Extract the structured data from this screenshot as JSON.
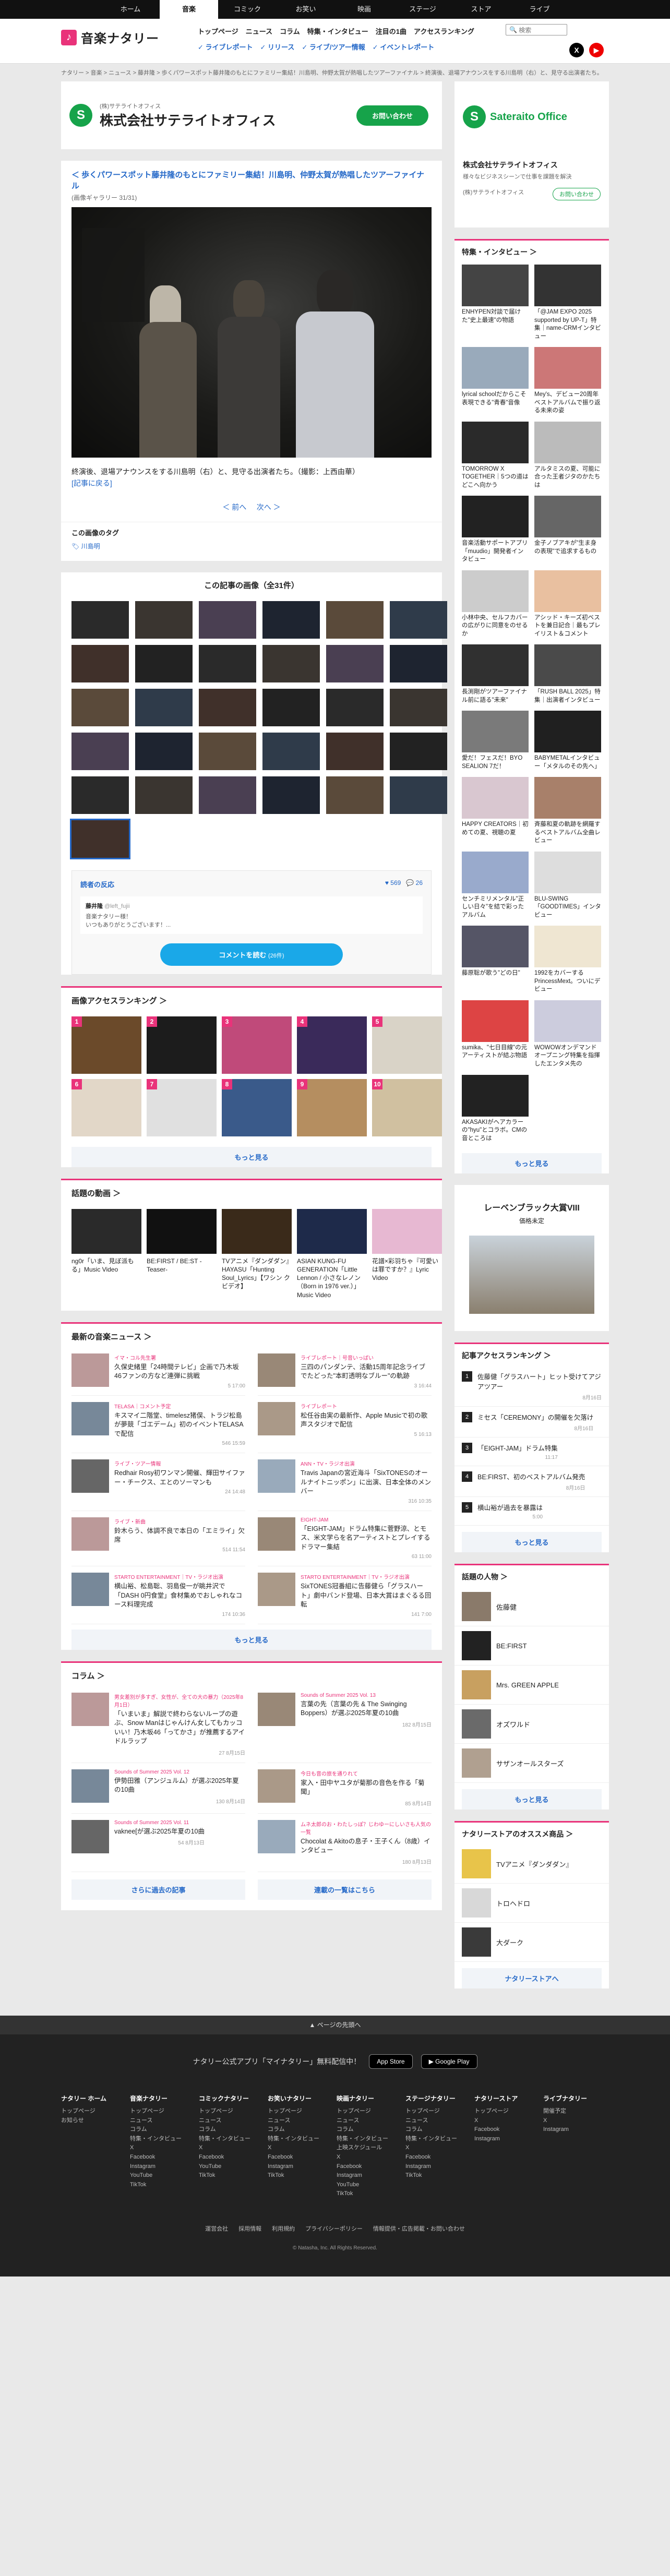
{
  "topnav": [
    "ホーム",
    "音楽",
    "コミック",
    "お笑い",
    "映画",
    "ステージ",
    "ストア",
    "ライブ"
  ],
  "header": {
    "logo": "音楽ナタリー",
    "search_placeholder": "検索",
    "menu1": [
      "トップページ",
      "ニュース",
      "コラム",
      "特集・インタビュー",
      "注目の1曲",
      "アクセスランキング"
    ],
    "menu2": [
      "ライブレポート",
      "リリース",
      "ライブ/ツアー情報",
      "イベントレポート"
    ]
  },
  "breadcrumb": "ナタリー > 音楽 > ニュース > 藤井隆 > 歩くパワースポット藤井隆のもとにファミリー集結！川島明、仲野太賀が熱唱したツアーファイナル > 終演後、退場アナウンスをする川島明（右）と、見守る出演者たち。",
  "ad_top": {
    "company_sub": "(株)サテライトオフィス",
    "company": "株式会社サテライトオフィス",
    "button": "お問い合わせ"
  },
  "article": {
    "back_link": "歩くパワースポット藤井隆のもとにファミリー集結！川島明、仲野太賀が熱唱したツアーファイナル",
    "gallery_count": "(画像ギャラリー 31/31)",
    "caption": "終演後、退場アナウンスをする川島明（右）と、見守る出演者たち。（撮影：上西由華）",
    "back_to_article": "[記事に戻る]",
    "prev": "＜ 前へ",
    "next": "次へ ＞",
    "tags_title": "この画像のタグ",
    "tag": "川島明"
  },
  "gallery": {
    "title": "この記事の画像（全31件）",
    "count": 31
  },
  "reactions": {
    "title": "読者の反応",
    "likes": "569",
    "comments": "26",
    "user": "藤井隆",
    "handle": "@left_fujii",
    "text": "音楽ナタリー様！\nいつもありがとうございます！...",
    "button": "コメントを読む",
    "button_count": "(26件)"
  },
  "image_ranking": {
    "title": "画像アクセスランキング",
    "more": "もっと見る",
    "count": 10
  },
  "videos": {
    "title": "話題の動画",
    "items": [
      {
        "title": "ng0r「いま、見ぼ派もる」Music Video"
      },
      {
        "title": "BE:FIRST / BE:ST -Teaser-"
      },
      {
        "title": "TVアニメ『ダンダダン』HAYASU「Hunting Soul_Lyrics」【ワシン クビデオ】"
      },
      {
        "title": "ASIAN KUNG-FU GENERATION「Little Lennon / 小さなレノン（Born in 1976 ver.）」Music Video"
      },
      {
        "title": "花譜×彩羽ちゃ『可愛いは罪ですか？』Lyric Video"
      }
    ]
  },
  "latest_news": {
    "title": "最新の音楽ニュース",
    "more": "もっと見る",
    "items": [
      {
        "cat": "イマ・コル先生署",
        "title": "久保史緒里「24時間テレビ」企画で乃木坂46ファンの方など連弾に挑戦",
        "meta": "5  17:00"
      },
      {
        "cat": "ライブレポート｜号音いっぱい",
        "title": "三四のパンダンテ、活動15周年記念ライブでたどった\"本町透明なブルー\"の軌跡",
        "meta": "3  16:44"
      },
      {
        "cat": "TELASA｜コメント予定",
        "title": "キスマイ二階堂、timelesz猪俣、トラジ松島が夢競「ゴエデーム」初のイベントTELASAで配信",
        "meta": "546  15:59"
      },
      {
        "cat": "ライブレポート",
        "title": "松任谷由実の最新作、Apple Musicで初の歌声スタジオで配信",
        "meta": "5  16:13"
      },
      {
        "cat": "ライブ・ツアー情報",
        "title": "Redhair Rosy初ワンマン開催、輝田サイファー・チークス、エとのソーマンも",
        "meta": "24  14:48"
      },
      {
        "cat": "ANN・TV・ラジオ出演",
        "title": "Travis Japanの宮近海斗「SixTONESのオールナイトニッポン」に出演、日本全体のメンバー",
        "meta": "316  10:35"
      },
      {
        "cat": "ライブ・新曲",
        "title": "鈴木らう、体調不良で本日の「エミライ」欠席",
        "meta": "514  11:54"
      },
      {
        "cat": "EIGHT-JAM",
        "title": "「EIGHT-JAM」ドラム特集に菅野涼、とモス、米文学らを名アーティストとプレイするドラマー集結",
        "meta": "63  11:00"
      },
      {
        "cat": "STARTO ENTERTAINMENT｜TV・ラジオ出演",
        "title": "横山裕、松島聡、羽島俊一が眺井沢で「DASH 0円食堂」食材集めでおしゃれなコース料理完成",
        "meta": "174  10:36"
      },
      {
        "cat": "STARTO ENTERTAINMENT｜TV・ラジオ出演",
        "title": "SixTONES冠番組に告藤健ら「グラスハート」劇中バンド登場、日本大賞はまぐるる回転",
        "meta": "141  7:00"
      }
    ]
  },
  "columns": {
    "title": "コラム",
    "more_left": "さらに過去の記事",
    "more_right": "連載の一覧はこちら",
    "items": [
      {
        "cat": "男女差別が多すぎ、女性が、全ての大の暴力（2025年8月1日）",
        "title": "「いまいま」解説で終わらないループの遊ぶ、Snow Manはじゃんけん女してもカッコいい！乃木坂46「ってかさ」が推薦するアイドルラップ",
        "meta": "27  8月15日"
      },
      {
        "cat": "Sounds of Summer 2025 Vol. 13",
        "title": "言葉の先（言葉の先 & The Swinging Boppers）が選ぶ2025年夏の10曲",
        "meta": "182  8月15日"
      },
      {
        "cat": "Sounds of Summer 2025 Vol. 12",
        "title": "伊勢田雅（アンジュルム）が選ぶ2025年夏の10曲",
        "meta": "130  8月14日"
      },
      {
        "cat": "今日も音の旅を通りれて",
        "title": "家入・田中ヤユタが菊那の音色を作る「菊聞」",
        "meta": "85  8月14日"
      },
      {
        "cat": "Sounds of Summer 2025 Vol. 11",
        "title": "vaknee[が選ぶ2025年夏の10曲",
        "meta": "54  8月13日"
      },
      {
        "cat": "ムネ太郎のお・わたしっぽ？じわゆーにしいさも人気の一覧",
        "title": "Chocolat & Akitoの息子・王子くん（8歳）インタビュー",
        "meta": "180  8月13日"
      }
    ]
  },
  "side_ad": {
    "company": "株式会社サテライトオフィス",
    "sub": "様々なビジネスシーンで仕事を課題を解決",
    "note": "(株)サテライトオフィス",
    "button": "お問い合わせ",
    "brand": "Sateraito Office"
  },
  "features": {
    "title": "特集・インタビュー",
    "more": "もっと見る",
    "items": [
      {
        "title": "ENHYPEN対談で届けた\"史上最速\"の物語"
      },
      {
        "title": "「@JAM EXPO 2025 supported by UP-T」特集｜name-CRMインタビュー"
      },
      {
        "title": "lyrical schoolだからこそ表現できる\"青春\"音像"
      },
      {
        "title": "Mey's、デビュー20周年ベストアルバムで振り返る未来の姿"
      },
      {
        "title": "TOMORROW X TOGETHER｜5つの道はどこへ向かう"
      },
      {
        "title": "アルタミスの夏、可能に合った王者ジタのかたちは"
      },
      {
        "title": "音楽活動サポートアプリ「muudio」開発者インタビュー"
      },
      {
        "title": "金子ノブアキが\"生ま身の表現\"で追求するもの"
      },
      {
        "title": "小林中央、セルフカバーの広がりに同意をのせるか"
      },
      {
        "title": "アシッド・キーズ初ベストを兼日記合｜最もプレイリスト＆コメント"
      },
      {
        "title": "長渕剛がツアーファイナル前に語る\"未来\""
      },
      {
        "title": "「RUSH BALL 2025」特集｜出演者インタビュー"
      },
      {
        "title": "愛だ！フェスだ！BYO SEALION 7だ！"
      },
      {
        "title": "BABYMETALインタビュー「メタルのその先へ」"
      },
      {
        "title": "HAPPY CREATORS｜初めての夏、視聴の夏"
      },
      {
        "title": "斉藤和夏の軌跡を網羅するベストアルバム全曲レビュー"
      },
      {
        "title": "センチミリメンタル\"正しい日々\"を結で彩ったアルバム"
      },
      {
        "title": "BLU-SWING「GOODTIMES」インタビュー"
      },
      {
        "title": "藤原聡が歌う\"どの日\""
      },
      {
        "title": "1992をカバーするPrincessMext。ついにデビュー"
      },
      {
        "title": "sumika、\"七日目線\"の元アーティストが結ぶ物語"
      },
      {
        "title": "WOWOWオンデマンドオープニング特集を指揮したエンタメ先の"
      },
      {
        "title": "AKASAKIがヘアカラー の\"hyu\"とコラボ。CMの音ところは"
      }
    ]
  },
  "side_ad2": {
    "title": "レーベンブラック大賞VIII",
    "sub": "価格未定"
  },
  "article_ranking": {
    "title": "記事アクセスランキング",
    "more": "もっと見る",
    "items": [
      {
        "title": "佐藤健「グラスハート」ヒット受けてアジアツアー",
        "meta": "8月16日"
      },
      {
        "title": "ミセス「CEREMONY」の開催を欠落け",
        "meta": "8月16日"
      },
      {
        "title": "「EIGHT-JAM」ドラム特集",
        "meta": "11:17"
      },
      {
        "title": "BE:FIRST、初のベストアルバム発売",
        "meta": "8月16日"
      },
      {
        "title": "横山裕が過去を暴露は",
        "meta": "5:00"
      }
    ]
  },
  "people": {
    "title": "話題の人物",
    "more": "もっと見る",
    "items": [
      "佐藤健",
      "BE:FIRST",
      "Mrs. GREEN APPLE",
      "オズワルド",
      "サザンオールスターズ"
    ]
  },
  "store": {
    "title": "ナタリーストアのオススメ商品",
    "more": "ナタリーストアへ",
    "items": [
      "TVアニメ『ダンダダン』",
      "トロヘドロ",
      "大ダーク"
    ]
  },
  "footer": {
    "back_top": "ページの先頭へ",
    "app_text": "ナタリー公式アプリ「マイナタリー」無料配信中！",
    "appstore": "App Store",
    "googleplay": "Google Play",
    "cols": [
      {
        "title": "ナタリー ホーム",
        "items": [
          "トップページ",
          "お知らせ"
        ]
      },
      {
        "title": "音楽ナタリー",
        "items": [
          "トップページ",
          "ニュース",
          "コラム",
          "特集・インタビュー",
          "X",
          "Facebook",
          "Instagram",
          "YouTube",
          "TikTok"
        ]
      },
      {
        "title": "コミックナタリー",
        "items": [
          "トップページ",
          "ニュース",
          "コラム",
          "特集・インタビュー",
          "X",
          "Facebook",
          "YouTube",
          "TikTok"
        ]
      },
      {
        "title": "お笑いナタリー",
        "items": [
          "トップページ",
          "ニュース",
          "コラム",
          "特集・インタビュー",
          "X",
          "Facebook",
          "Instagram",
          "TikTok"
        ]
      },
      {
        "title": "映画ナタリー",
        "items": [
          "トップページ",
          "ニュース",
          "コラム",
          "特集・インタビュー",
          "上映スケジュール",
          "X",
          "Facebook",
          "Instagram",
          "YouTube",
          "TikTok"
        ]
      },
      {
        "title": "ステージナタリー",
        "items": [
          "トップページ",
          "ニュース",
          "コラム",
          "特集・インタビュー",
          "X",
          "Facebook",
          "Instagram",
          "TikTok"
        ]
      },
      {
        "title": "ナタリーストア",
        "items": [
          "トップページ",
          "X",
          "Facebook",
          "Instagram"
        ]
      },
      {
        "title": "ライブナタリー",
        "items": [
          "開催予定",
          "X",
          "Instagram"
        ]
      }
    ],
    "links": [
      "運営会社",
      "採用情報",
      "利用規約",
      "プライバシーポリシー",
      "情報提供・広告掲載・お問い合わせ"
    ],
    "copyright": "© Natasha, Inc. All Rights Reserved."
  }
}
